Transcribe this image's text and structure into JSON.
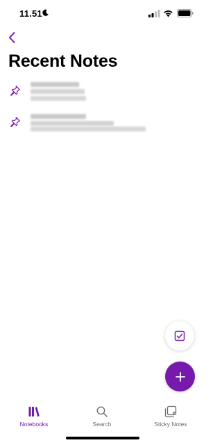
{
  "status_bar": {
    "time": "11.51",
    "icons": [
      "moon-icon",
      "cellular-signal-icon",
      "wifi-icon",
      "battery-icon"
    ]
  },
  "header": {
    "back_icon": "chevron-left-icon",
    "title": "Recent Notes"
  },
  "notes": [
    {
      "icon": "pin-icon",
      "pinned": true
    },
    {
      "icon": "pin-icon",
      "pinned": true
    }
  ],
  "actions": {
    "secondary_icon": "checkbox-icon",
    "primary_icon": "plus-icon"
  },
  "tab_bar": {
    "tabs": [
      {
        "label": "Notebooks",
        "icon": "notebooks-icon",
        "active": true
      },
      {
        "label": "Search",
        "icon": "search-icon",
        "active": false
      },
      {
        "label": "Sticky Notes",
        "icon": "sticky-notes-icon",
        "active": false
      }
    ]
  },
  "colors": {
    "accent": "#7719aa",
    "inactive": "#6b6b6b",
    "background": "#ffffff"
  }
}
